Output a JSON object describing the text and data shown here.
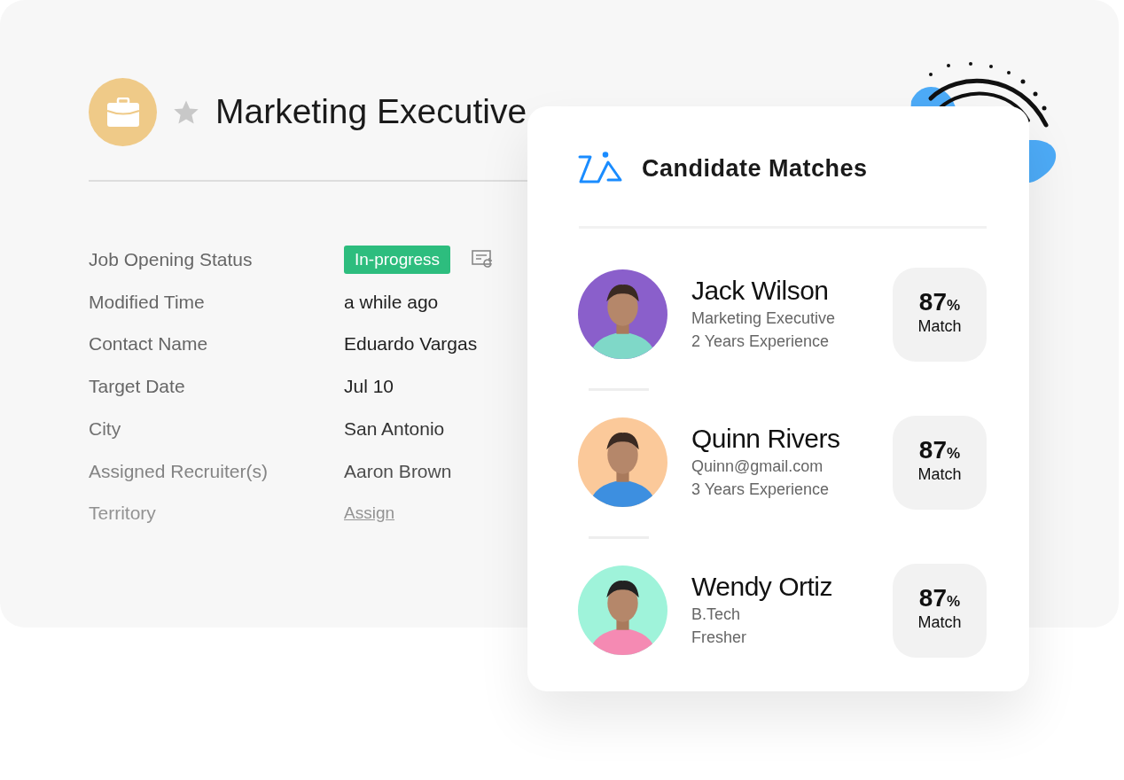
{
  "job": {
    "title": "Marketing Executive",
    "starred": false
  },
  "fields": [
    {
      "label": "Job Opening Status",
      "value": "In-progress",
      "kind": "badge"
    },
    {
      "label": "Modified Time",
      "value": "a while ago",
      "kind": "text"
    },
    {
      "label": "Contact Name",
      "value": "Eduardo Vargas",
      "kind": "text"
    },
    {
      "label": "Target Date",
      "value": "Jul 10",
      "kind": "text"
    },
    {
      "label": "City",
      "value": "San Antonio",
      "kind": "text"
    },
    {
      "label": "Assigned Recruiter(s)",
      "value": "Aaron Brown",
      "kind": "text"
    },
    {
      "label": "Territory",
      "value": "Assign",
      "kind": "link"
    }
  ],
  "matches": {
    "title": "Candidate Matches",
    "candidates": [
      {
        "name": "Jack Wilson",
        "line_1": "Marketing Executive",
        "line_2": "2 Years Experience",
        "score": "87",
        "score_unit": "%",
        "score_label": "Match"
      },
      {
        "name": "Quinn Rivers",
        "line_1": "Quinn@gmail.com",
        "line_2": "3 Years Experience",
        "score": "87",
        "score_unit": "%",
        "score_label": "Match"
      },
      {
        "name": "Wendy Ortiz",
        "line_1": "B.Tech",
        "line_2": "Fresher",
        "score": "87",
        "score_unit": "%",
        "score_label": "Match"
      }
    ]
  }
}
